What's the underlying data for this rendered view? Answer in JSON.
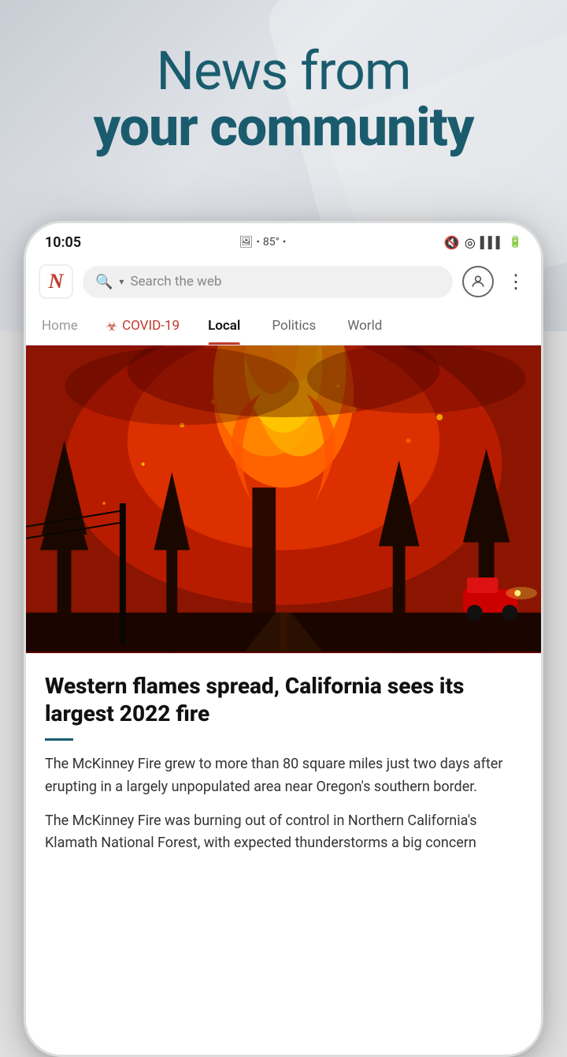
{
  "background": {
    "color": "#e0e3e8"
  },
  "header": {
    "line1": "News from",
    "line2": "your community"
  },
  "status_bar": {
    "time": "10:05",
    "indicators": "● 85° •",
    "icons": "🔇 ◎ ▌▌▌ 🔋"
  },
  "address_bar": {
    "logo_text": "N",
    "search_placeholder": "Search the web",
    "search_icon": "🔍",
    "dropdown_arrow": "▾",
    "user_icon": "👤",
    "menu_icon": "⋮"
  },
  "nav_tabs": {
    "items": [
      {
        "label": "Home",
        "id": "home",
        "active": false
      },
      {
        "label": "COVID-19",
        "id": "covid",
        "active": false,
        "has_icon": true
      },
      {
        "label": "Local",
        "id": "local",
        "active": true
      },
      {
        "label": "Politics",
        "id": "politics",
        "active": false
      },
      {
        "label": "World",
        "id": "world",
        "active": false
      }
    ]
  },
  "article": {
    "title": "Western flames spread, California sees its largest 2022 fire",
    "divider_color": "#1a5c6e",
    "body1": "The McKinney Fire grew to more than 80 square miles just two days after erupting in a largely unpopulated area near Oregon's southern border.",
    "body2": "The McKinney Fire was burning out of control in Northern California's Klamath National Forest, with expected thunderstorms a big concern"
  }
}
